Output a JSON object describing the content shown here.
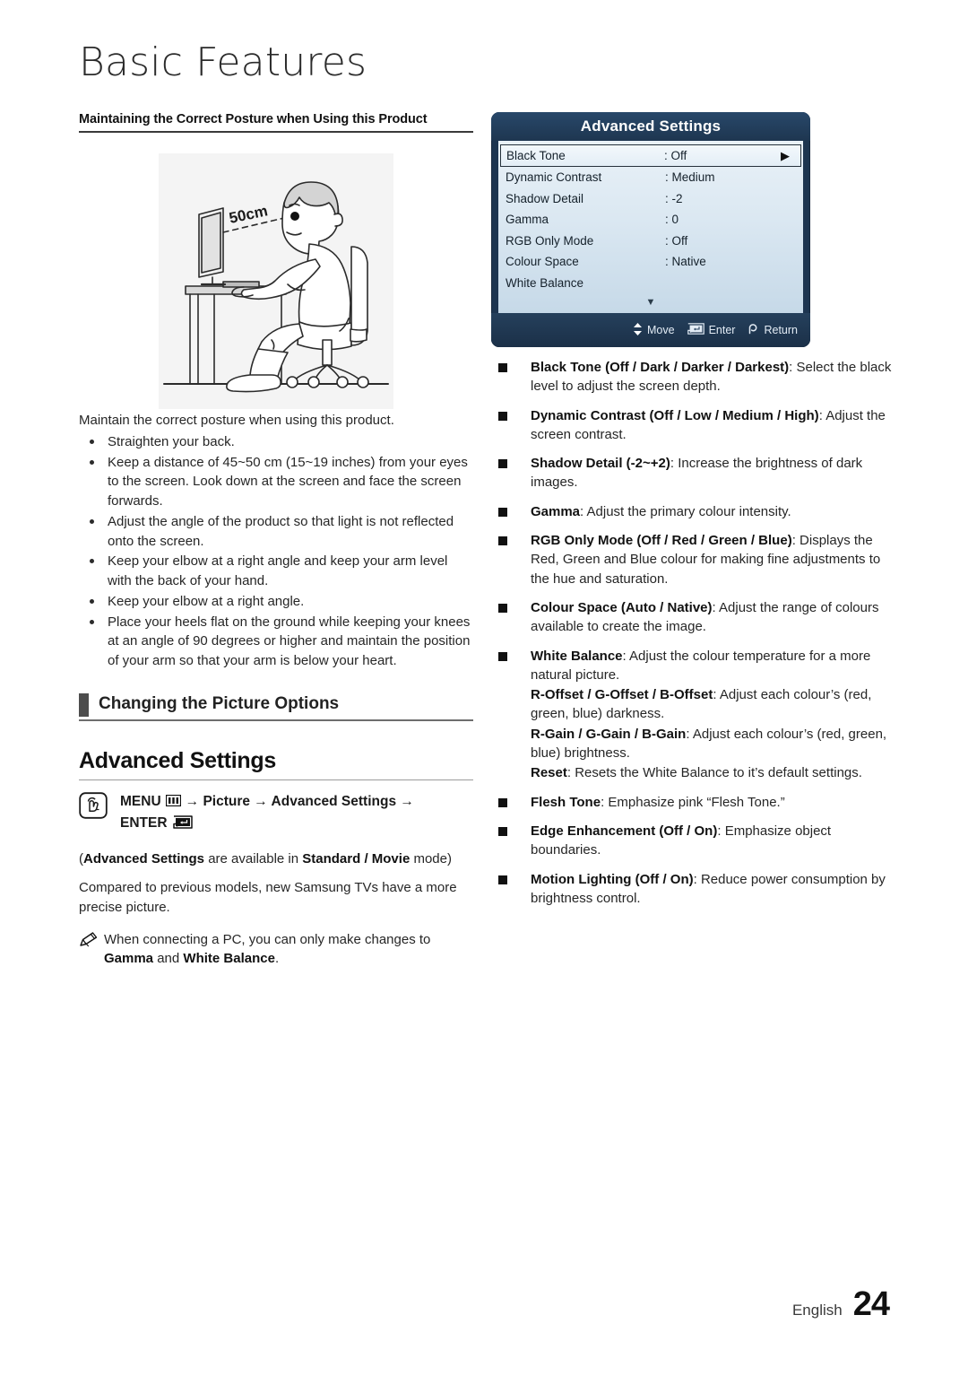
{
  "page": {
    "chapter_title": "Basic Features",
    "footer_language": "English",
    "footer_page_number": "24"
  },
  "left": {
    "posture_heading": "Maintaining the Correct Posture when Using this Product",
    "figure": {
      "name": "posture-illustration",
      "distance_label": "50cm"
    },
    "intro": "Maintain the correct posture when using this product.",
    "tips": [
      "Straighten your back.",
      "Keep a distance of 45~50 cm (15~19 inches) from your eyes to the screen. Look down at the screen and face the screen forwards.",
      "Adjust the angle of the product so that light is not reflected onto the screen.",
      "Keep your elbow at a right angle and keep your arm level with the back of your hand.",
      "Keep your elbow at a right angle.",
      "Place your heels flat on the ground while keeping your knees at an angle of 90 degrees or higher and maintain the position of your arm so that your arm is below your heart."
    ],
    "section_heading": "Changing the Picture Options",
    "big_heading": "Advanced Settings",
    "menu_path_line1_pre": "MENU",
    "menu_path_line1_post": "→ Picture → Advanced Settings →",
    "menu_path_line2": "ENTER",
    "availability_note_a": "(",
    "availability_note_b": "Advanced Settings",
    "availability_note_c": " are available in ",
    "availability_note_d": "Standard / Movie",
    "availability_note_e": " mode)",
    "precision_note": "Compared to previous models, new Samsung TVs have a more precise picture.",
    "pc_note_pre": "When connecting a PC, you can only make changes to ",
    "pc_note_bold1": "Gamma",
    "pc_note_mid": " and ",
    "pc_note_bold2": "White Balance",
    "pc_note_end": "."
  },
  "osd": {
    "title": "Advanced Settings",
    "rows": [
      {
        "label": "Black Tone",
        "value": ": Off",
        "arrow": "▶",
        "selected": true
      },
      {
        "label": "Dynamic Contrast",
        "value": ": Medium",
        "arrow": "",
        "selected": false
      },
      {
        "label": "Shadow Detail",
        "value": ": -2",
        "arrow": "",
        "selected": false
      },
      {
        "label": "Gamma",
        "value": ": 0",
        "arrow": "",
        "selected": false
      },
      {
        "label": "RGB Only Mode",
        "value": ": Off",
        "arrow": "",
        "selected": false
      },
      {
        "label": "Colour Space",
        "value": ": Native",
        "arrow": "",
        "selected": false
      },
      {
        "label": "White Balance",
        "value": "",
        "arrow": "",
        "selected": false
      }
    ],
    "scroll_down_glyph": "▼",
    "footer": {
      "move": "Move",
      "enter": "Enter",
      "return": "Return"
    }
  },
  "right_items": [
    {
      "bold": "Black Tone (Off / Dark / Darker / Darkest)",
      "rest": ": Select the black level to adjust the screen depth.",
      "marker": true
    },
    {
      "bold": "Dynamic Contrast (Off / Low / Medium / High)",
      "rest": ": Adjust the screen contrast.",
      "marker": true
    },
    {
      "bold": "Shadow Detail (-2~+2)",
      "rest": ": Increase the brightness of dark images.",
      "marker": true
    },
    {
      "bold": "Gamma",
      "rest": ": Adjust the primary colour intensity.",
      "marker": true
    },
    {
      "bold": "RGB Only Mode (Off / Red / Green / Blue)",
      "rest": ": Displays the Red, Green and Blue colour for making fine adjustments to the hue and saturation.",
      "marker": true
    },
    {
      "bold": "Colour Space (Auto / Native)",
      "rest": ": Adjust the range of colours available to create the image.",
      "marker": true
    },
    {
      "bold": "White Balance",
      "rest": ": Adjust the colour temperature for a more natural picture.",
      "marker": true,
      "sublines": [
        {
          "bold": "R-Offset / G-Offset / B-Offset",
          "rest": ": Adjust each colour’s (red, green, blue) darkness."
        },
        {
          "bold": "R-Gain / G-Gain / B-Gain",
          "rest": ": Adjust each colour’s (red, green, blue) brightness."
        },
        {
          "bold": "Reset",
          "rest": ": Resets the White Balance to it’s default settings."
        }
      ]
    },
    {
      "bold": "Flesh Tone",
      "rest": ": Emphasize pink “Flesh Tone.”",
      "marker": true
    },
    {
      "bold": "Edge Enhancement (Off / On)",
      "rest": ": Emphasize object boundaries.",
      "marker": true
    },
    {
      "bold": "Motion Lighting (Off / On)",
      "rest": ": Reduce power consumption by brightness control.",
      "marker": true
    }
  ],
  "colors": {
    "osd_header": "#24405f",
    "osd_body_top": "#e9f1f7",
    "osd_body_bottom": "#c6d9e8",
    "accent_bar": "#4d4d4d",
    "text": "#262626"
  }
}
